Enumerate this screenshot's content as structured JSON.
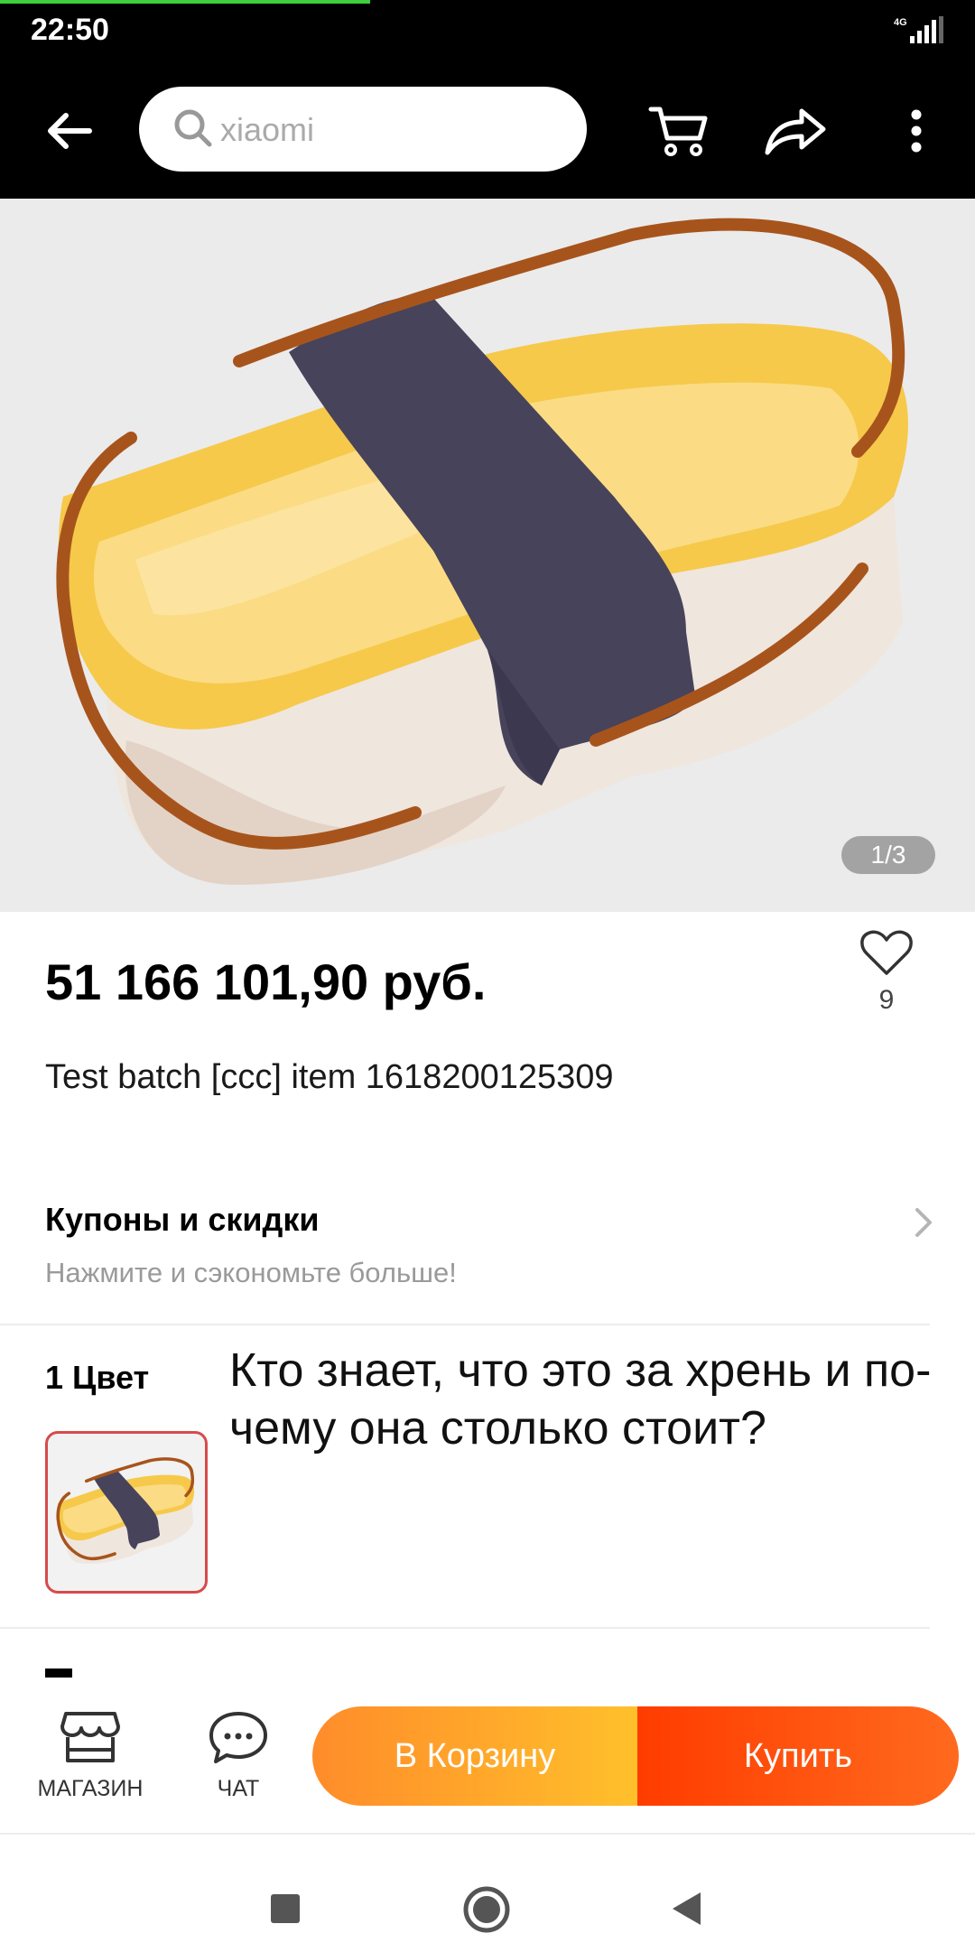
{
  "status_bar": {
    "time": "22:50",
    "network": "4G"
  },
  "search": {
    "placeholder": "xiaomi"
  },
  "gallery": {
    "counter": "1/3"
  },
  "product": {
    "price": "51 166 101,90 руб.",
    "favorites_count": "9",
    "title": "Test batch [ccc] item 1618200125309"
  },
  "coupons": {
    "title": "Купоны и скидки",
    "subtitle": "Нажмите и сэкономьте больше!"
  },
  "variants": {
    "label": "1 Цвет"
  },
  "overlay_question": {
    "line1": "Кто знает, что это за хрень и по-",
    "line2": "чему она столько стоит?"
  },
  "action_bar": {
    "shop_label": "МАГАЗИН",
    "chat_label": "ЧАТ",
    "cart_label": "В Корзину",
    "buy_label": "Купить"
  },
  "colors": {
    "buy": "#ff3c00",
    "cart": "#ff9b22",
    "accent_border": "#d74b4b"
  }
}
